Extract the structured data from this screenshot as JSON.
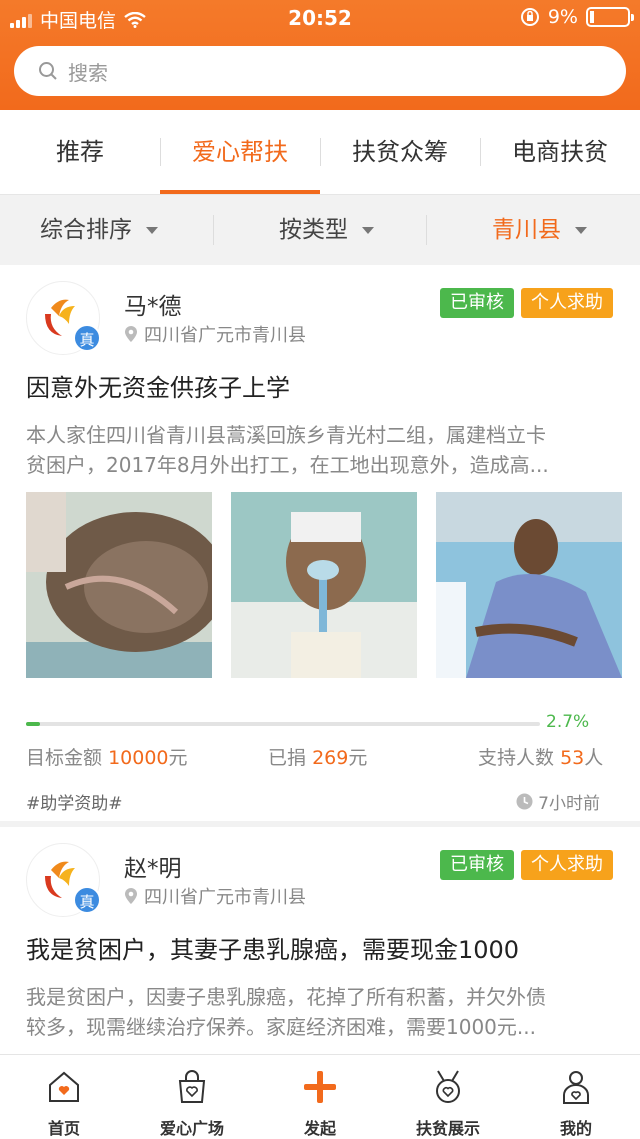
{
  "status_bar": {
    "carrier": "中国电信",
    "time": "20:52",
    "battery": "9%"
  },
  "search": {
    "placeholder": "搜索"
  },
  "tabs": [
    {
      "label": "推荐",
      "active": false
    },
    {
      "label": "爱心帮扶",
      "active": true
    },
    {
      "label": "扶贫众筹",
      "active": false
    },
    {
      "label": "电商扶贫",
      "active": false
    }
  ],
  "filters": [
    {
      "label": "综合排序"
    },
    {
      "label": "按类型"
    },
    {
      "label": "青川县",
      "active": true
    }
  ],
  "posts": [
    {
      "name": "马*德",
      "location": "四川省广元市青川县",
      "verified_mark": "真",
      "badges": [
        "已审核",
        "个人求助"
      ],
      "title": "因意外无资金供孩子上学",
      "desc_line1": "本人家住四川省青川县蒿溪回族乡青光村二组，属建档立卡",
      "desc_line2": "贫困户，2017年8月外出打工，在工地出现意外，造成高...",
      "progress_percent": 2.7,
      "progress_label": "2.7%",
      "target_label": "目标金额",
      "target_value": "10000",
      "donated_label": "已捐",
      "donated_value": "269",
      "supporters_label": "支持人数",
      "supporters_value": "53",
      "unit_yuan": "元",
      "unit_person": "人",
      "tag": "#助学资助#",
      "time_ago": "7小时前"
    },
    {
      "name": "赵*明",
      "location": "四川省广元市青川县",
      "verified_mark": "真",
      "badges": [
        "已审核",
        "个人求助"
      ],
      "title": "我是贫困户，其妻子患乳腺癌，需要现金1000",
      "desc_line1": "我是贫困户，因妻子患乳腺癌，花掉了所有积蓄，并欠外债",
      "desc_line2": "较多，现需继续治疗保养。家庭经济困难，需要1000元..."
    }
  ],
  "bottom_nav": [
    {
      "label": "首页",
      "icon": "home-heart-icon"
    },
    {
      "label": "爱心广场",
      "icon": "heart-bag-icon"
    },
    {
      "label": "发起",
      "icon": "plus-icon"
    },
    {
      "label": "扶贫展示",
      "icon": "medal-heart-icon"
    },
    {
      "label": "我的",
      "icon": "person-heart-icon"
    }
  ],
  "colors": {
    "accent": "#f26a1c",
    "verified": "#4cb84c",
    "help": "#f7a21b",
    "badge_blue": "#3c8be0"
  }
}
